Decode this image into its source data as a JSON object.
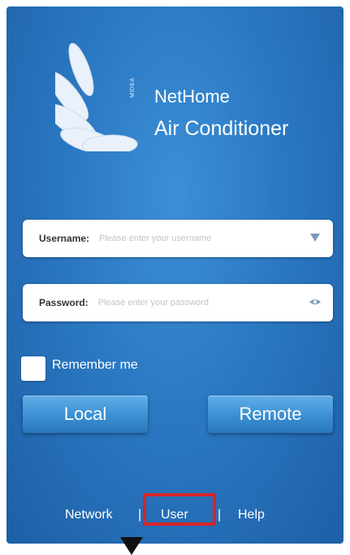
{
  "app": {
    "title": "NetHome",
    "subtitle": "Air Conditioner",
    "brand_vertical": "MIDEA"
  },
  "form": {
    "username": {
      "label": "Username:",
      "placeholder": "Please enter your username"
    },
    "password": {
      "label": "Password:",
      "placeholder": "Please enter your password"
    },
    "remember_label": "Remember me"
  },
  "buttons": {
    "local": "Local",
    "remote": "Remote"
  },
  "footer": {
    "network": "Network",
    "sep1": "|",
    "user": "User",
    "sep2": "|",
    "help": "Help"
  },
  "colors": {
    "background": "#2b78c2",
    "highlight": "#d8232a"
  }
}
